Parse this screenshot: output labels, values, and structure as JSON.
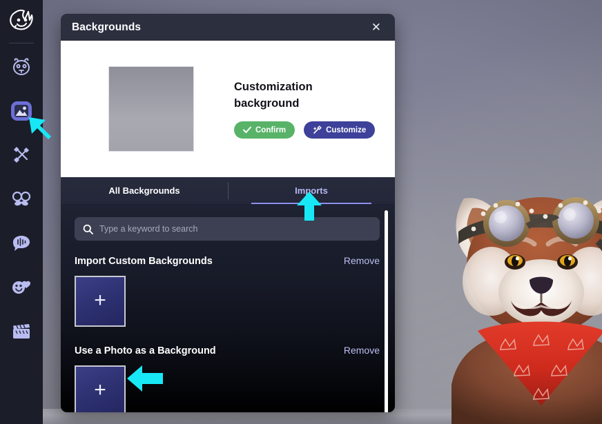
{
  "app": {
    "logo_icon": "avatar-face-logo",
    "sidebar": {
      "items": [
        {
          "id": "characters",
          "icon": "panda-face-icon",
          "label": "Characters",
          "active": false
        },
        {
          "id": "backgrounds",
          "icon": "image-landscape-icon",
          "label": "Backgrounds",
          "active": true
        },
        {
          "id": "props",
          "icon": "brush-and-tool-icon",
          "label": "Props",
          "active": false
        },
        {
          "id": "accessories",
          "icon": "glasses-mustache-icon",
          "label": "Accessories",
          "active": false
        },
        {
          "id": "voice",
          "icon": "speech-bubble-waveform-icon",
          "label": "Voice",
          "active": false
        },
        {
          "id": "stickers",
          "icon": "smiley-heart-icon",
          "label": "Stickers",
          "active": false
        },
        {
          "id": "scenes",
          "icon": "clapperboard-icon",
          "label": "Scenes",
          "active": false
        }
      ]
    }
  },
  "dialog": {
    "title": "Backgrounds",
    "close_icon": "close-icon",
    "preview": {
      "thumbnail_alt": "gray gradient background thumbnail",
      "title": "Customization background",
      "confirm_label": "Confirm",
      "confirm_icon": "check-icon",
      "confirm_color": "#58b368",
      "customize_label": "Customize",
      "customize_icon": "magic-wand-icon",
      "customize_color": "#3d4199"
    },
    "tabs": [
      {
        "id": "all-backgrounds",
        "label": "All Backgrounds",
        "active": false
      },
      {
        "id": "imports",
        "label": "Imports",
        "active": true
      }
    ],
    "active_tab_accent": "#8d91ee",
    "search": {
      "icon": "search-icon",
      "value": "",
      "placeholder": "Type a keyword to search"
    },
    "sections": [
      {
        "id": "import-custom-backgrounds",
        "title": "Import Custom Backgrounds",
        "remove_label": "Remove",
        "tiles": [
          {
            "id": "add-custom-background",
            "icon": "plus-icon",
            "label": "+"
          }
        ]
      },
      {
        "id": "use-a-photo-as-a-background",
        "title": "Use a Photo as a Background",
        "remove_label": "Remove",
        "tiles": [
          {
            "id": "add-photo-background",
            "icon": "plus-icon",
            "label": "+"
          }
        ]
      }
    ],
    "scrollbar": {
      "visible": true,
      "color": "#ffffff"
    }
  },
  "stage": {
    "avatar_alt": "3D red panda character with aviator goggles and red bandana",
    "background_description": "gray-purple studio gradient backdrop"
  },
  "annotations": {
    "accent_color": "#18E8F5",
    "arrows": [
      {
        "id": "arrow-sidebar",
        "points_to": "sidebar-item-backgrounds",
        "direction": "up-left"
      },
      {
        "id": "arrow-tab",
        "points_to": "tab-imports",
        "direction": "up"
      },
      {
        "id": "arrow-tile",
        "points_to": "add-photo-background",
        "direction": "left"
      }
    ]
  }
}
